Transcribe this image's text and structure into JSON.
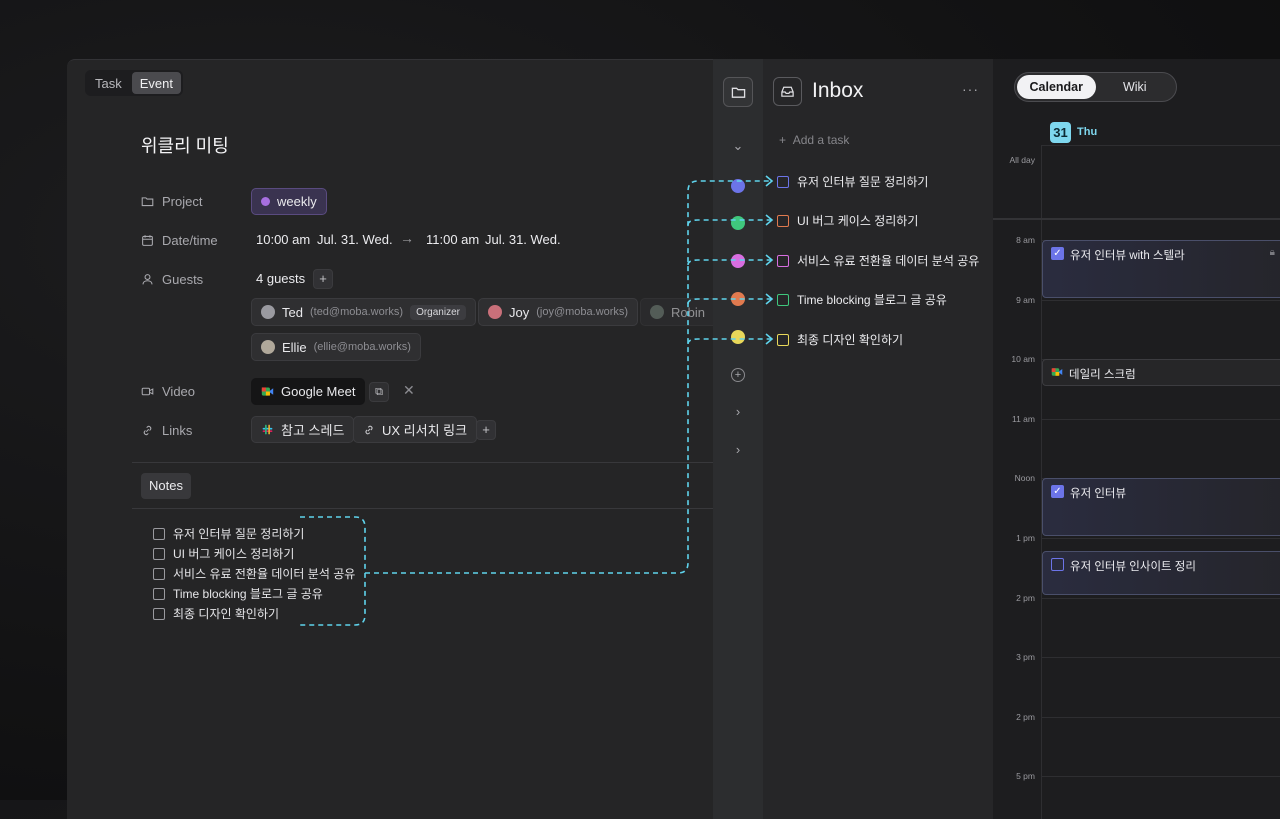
{
  "event": {
    "tabs": [
      "Task",
      "Event"
    ],
    "active_tab": "Event",
    "title": "위클리 미팅",
    "labels": {
      "project": "Project",
      "datetime": "Date/time",
      "guests": "Guests",
      "video": "Video",
      "links": "Links"
    },
    "project": {
      "name": "weekly",
      "color": "#a76fe0"
    },
    "datetime": {
      "start_time": "10:00 am",
      "start_date": "Jul. 31. Wed.",
      "end_time": "11:00 am",
      "end_date": "Jul. 31. Wed."
    },
    "guests_count": "4 guests",
    "guests": [
      {
        "name": "Ted",
        "email": "(ted@moba.works)",
        "badge": "Organizer"
      },
      {
        "name": "Joy",
        "email": "(joy@moba.works)"
      },
      {
        "name": "Robin"
      },
      {
        "name": "Ellie",
        "email": "(ellie@moba.works)"
      }
    ],
    "video": {
      "label": "Google Meet"
    },
    "links": [
      {
        "label": "참고 스레드"
      },
      {
        "label": "UX 리서치 링크"
      }
    ],
    "notes_label": "Notes",
    "notes": [
      "유저 인터뷰 질문 정리하기",
      "UI 버그 케이스 정리하기",
      "서비스 유료 전환율 데이터 분석 공유",
      "Time blocking 블로그 글 공유",
      "최종 디자인 확인하기"
    ]
  },
  "inbox": {
    "title": "Inbox",
    "add_task": "Add a task",
    "items": [
      {
        "label": "유저 인터뷰 질문 정리하기",
        "color": "#6c74e8",
        "dot": "#6c74e8"
      },
      {
        "label": "UI 버그 케이스 정리하기",
        "color": "#e07a4f",
        "dot": "#3fc77d"
      },
      {
        "label": "서비스 유료 전환율 데이터 분석 공유",
        "color": "#d86ee0",
        "dot": "#d86ee0"
      },
      {
        "label": "Time blocking 블로그 글 공유",
        "color": "#3fc77d",
        "dot": "#e07a4f"
      },
      {
        "label": "최종 디자인 확인하기",
        "color": "#e8d85a",
        "dot": "#e8d85a"
      }
    ]
  },
  "calendar": {
    "tabs": [
      "Calendar",
      "Wiki"
    ],
    "active_tab": "Calendar",
    "day_number": "31",
    "day_name": "Thu",
    "all_day": "All day",
    "hours": [
      "8 am",
      "9 am",
      "10 am",
      "11 am",
      "Noon",
      "1 pm",
      "2 pm",
      "3 pm",
      "2 pm",
      "5 pm"
    ],
    "events": [
      {
        "title": "유저 인터뷰 with 스텔라",
        "checked": true
      },
      {
        "title": "데일리 스크럼",
        "checked": false
      },
      {
        "title": "유저 인터뷰",
        "checked": true
      },
      {
        "title": "유저 인터뷰 인사이트 정리",
        "checked": false
      }
    ]
  },
  "colors": {
    "connector": "#5fd3ec",
    "accent": "#6c74e8"
  }
}
